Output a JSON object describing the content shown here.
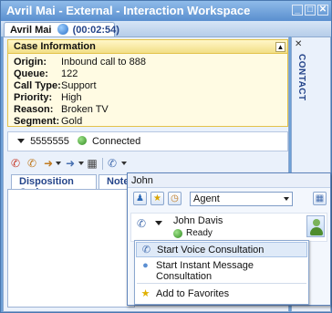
{
  "window": {
    "title": "Avril Mai - External - Interaction Workspace"
  },
  "tab": {
    "label": "Avril Mai",
    "timer": "(00:02:54)"
  },
  "side_rail": {
    "label": "CONTACT",
    "close": "✕"
  },
  "case_info": {
    "title": "Case Information",
    "rows": [
      {
        "key": "Origin:",
        "value": "Inbound call to 888"
      },
      {
        "key": "Queue:",
        "value": "122"
      },
      {
        "key": "Call Type:",
        "value": "Support"
      },
      {
        "key": "Priority:",
        "value": "High"
      },
      {
        "key": "Reason:",
        "value": "Broken TV"
      },
      {
        "key": "Segment:",
        "value": "Gold"
      }
    ]
  },
  "call": {
    "number": "5555555",
    "status": "Connected"
  },
  "subtabs": {
    "disposition": "Disposition Code",
    "note": "Note"
  },
  "popup": {
    "search_value": "John",
    "filter_value": "Agent",
    "contact_name": "John Davis",
    "contact_status": "Ready",
    "menu": {
      "voice": "Start Voice Consultation",
      "im": "Start Instant Message Consultation",
      "favorites": "Add to Favorites"
    }
  },
  "colors": {
    "accent": "#5a8fcf",
    "case_border": "#e3c24a",
    "menu_highlight": "#dfeaf8"
  }
}
